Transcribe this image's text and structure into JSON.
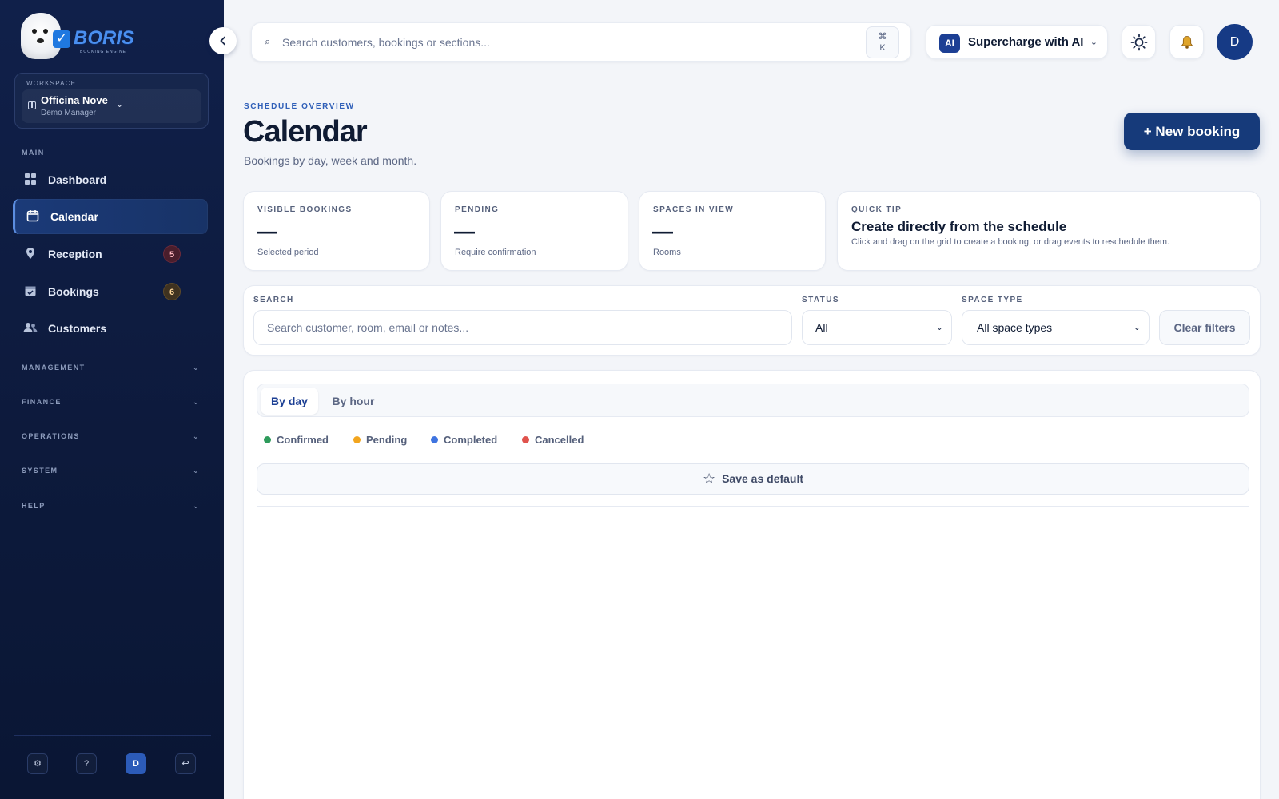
{
  "brand": {
    "name": "BORIS",
    "subtitle": "BOOKING ENGINE"
  },
  "workspace": {
    "label": "WORKSPACE",
    "name": "Officina Nove",
    "role": "Demo Manager"
  },
  "sidebar": {
    "main_label": "MAIN",
    "items": [
      {
        "label": "Dashboard",
        "icon": "grid-icon"
      },
      {
        "label": "Calendar",
        "icon": "calendar-icon",
        "active": true
      },
      {
        "label": "Reception",
        "icon": "location-pin-icon",
        "badge": "5"
      },
      {
        "label": "Bookings",
        "icon": "calendar-check-icon",
        "badge": "6"
      },
      {
        "label": "Customers",
        "icon": "users-icon"
      }
    ],
    "groups": [
      "MANAGEMENT",
      "FINANCE",
      "OPERATIONS",
      "SYSTEM",
      "HELP"
    ],
    "footer": {
      "settings_icon": "gear-icon",
      "help": "?",
      "avatar": "D",
      "logout_icon": "logout-icon"
    }
  },
  "topbar": {
    "search_placeholder": "Search customers, bookings or sections...",
    "kbd_cmd": "⌘",
    "kbd_key": "K",
    "ai_badge": "AI",
    "ai_label": "Supercharge with AI",
    "avatar": "D"
  },
  "header": {
    "kicker": "SCHEDULE OVERVIEW",
    "title": "Calendar",
    "subtitle": "Bookings by day, week and month.",
    "new_booking": "+ New booking"
  },
  "stats": [
    {
      "label": "VISIBLE BOOKINGS",
      "value": "—",
      "foot": "Selected period"
    },
    {
      "label": "PENDING",
      "value": "—",
      "foot": "Require confirmation"
    },
    {
      "label": "SPACES IN VIEW",
      "value": "—",
      "foot": "Rooms"
    }
  ],
  "tip": {
    "label": "QUICK TIP",
    "title": "Create directly from the schedule",
    "body": "Click and drag on the grid to create a booking, or drag events to reschedule them."
  },
  "filters": {
    "search_label": "SEARCH",
    "search_placeholder": "Search customer, room, email or notes...",
    "status_label": "STATUS",
    "status_value": "All",
    "space_label": "SPACE TYPE",
    "space_value": "All space types",
    "clear": "Clear filters"
  },
  "calendar": {
    "tabs": [
      "By day",
      "By hour"
    ],
    "legend": [
      {
        "label": "Confirmed",
        "color": "#2e9b5b"
      },
      {
        "label": "Pending",
        "color": "#f2a51e"
      },
      {
        "label": "Completed",
        "color": "#3f74e0"
      },
      {
        "label": "Cancelled",
        "color": "#e0534d"
      }
    ],
    "save_default": "Save as default"
  }
}
